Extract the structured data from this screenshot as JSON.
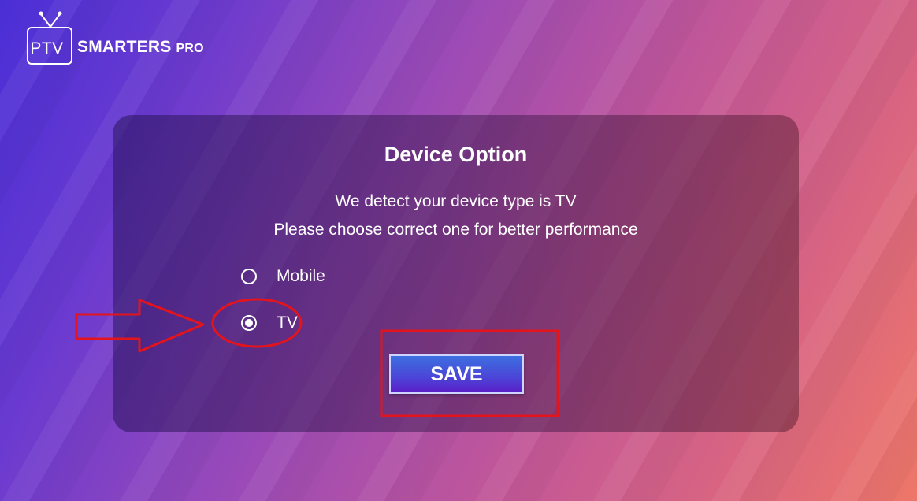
{
  "logo": {
    "iptv": "IPTV",
    "smarters": "SMARTERS",
    "pro": "PRO"
  },
  "dialog": {
    "title": "Device Option",
    "line1": "We detect your device type is TV",
    "line2": "Please choose correct one for better performance",
    "options": [
      {
        "label": "Mobile",
        "selected": false
      },
      {
        "label": "TV",
        "selected": true
      }
    ],
    "save_label": "SAVE"
  },
  "colors": {
    "annotation": "#e3141c",
    "save_button": "#4a48d8"
  }
}
